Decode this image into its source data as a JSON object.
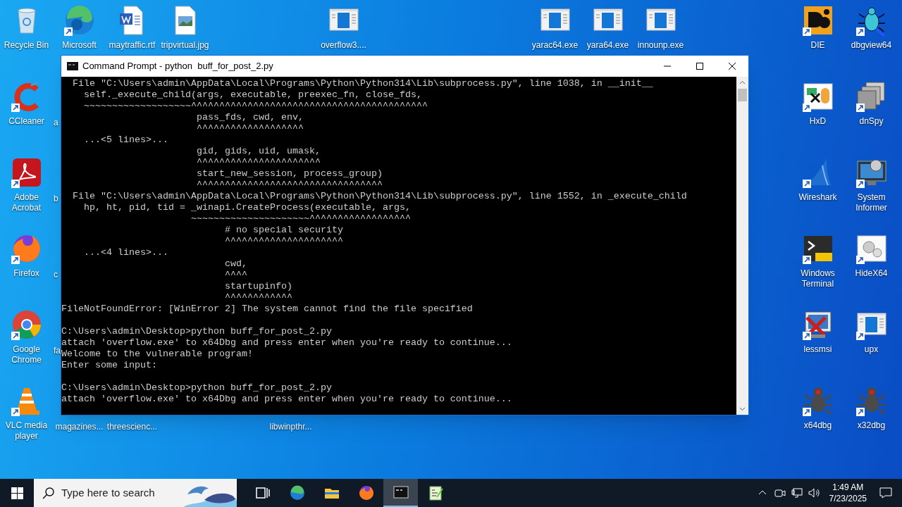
{
  "desktop": {
    "icons": [
      {
        "label": "Recycle Bin",
        "kind": "recycle",
        "shortcut": false
      },
      {
        "label": "Microsoft",
        "kind": "edge",
        "shortcut": true
      },
      {
        "label": "maytraffic.rtf",
        "kind": "word",
        "shortcut": false
      },
      {
        "label": "tripvirtual.jpg",
        "kind": "image",
        "shortcut": false
      },
      {
        "label": "overflow3....",
        "kind": "exe",
        "shortcut": false
      },
      {
        "label": "yarac64.exe",
        "kind": "exe",
        "shortcut": false
      },
      {
        "label": "yara64.exe",
        "kind": "exe",
        "shortcut": false
      },
      {
        "label": "innounp.exe",
        "kind": "exe",
        "shortcut": false
      },
      {
        "label": "DIE",
        "kind": "die",
        "shortcut": true
      },
      {
        "label": "dbgview64",
        "kind": "bug",
        "shortcut": true
      },
      {
        "label": "CCleaner",
        "kind": "ccleaner",
        "shortcut": true
      },
      {
        "label": "a",
        "kind": "hidden"
      },
      {
        "label": "HxD",
        "kind": "hxd",
        "shortcut": true
      },
      {
        "label": "dnSpy",
        "kind": "dnspy",
        "shortcut": true
      },
      {
        "label": "Adobe Acrobat",
        "kind": "acrobat",
        "shortcut": true
      },
      {
        "label": "b",
        "kind": "hidden"
      },
      {
        "label": "Wireshark",
        "kind": "wireshark",
        "shortcut": true
      },
      {
        "label": "System Informer",
        "kind": "sysinfo",
        "shortcut": true
      },
      {
        "label": "Firefox",
        "kind": "firefox",
        "shortcut": true
      },
      {
        "label": "c",
        "kind": "hidden"
      },
      {
        "label": "Windows Terminal",
        "kind": "terminal",
        "shortcut": true
      },
      {
        "label": "HideX64",
        "kind": "hidex",
        "shortcut": true
      },
      {
        "label": "Google Chrome",
        "kind": "chrome",
        "shortcut": true
      },
      {
        "label": "fa",
        "kind": "hidden"
      },
      {
        "label": "lessmsi",
        "kind": "lessmsi",
        "shortcut": true
      },
      {
        "label": "upx",
        "kind": "exe",
        "shortcut": true
      },
      {
        "label": "VLC media player",
        "kind": "vlc",
        "shortcut": true
      },
      {
        "label": "magazines...",
        "kind": "hidden"
      },
      {
        "label": "threescienc...",
        "kind": "hidden"
      },
      {
        "label": "libwinpthr...",
        "kind": "hidden"
      },
      {
        "label": "x64dbg",
        "kind": "dbg",
        "shortcut": true
      },
      {
        "label": "x32dbg",
        "kind": "dbg",
        "shortcut": true
      }
    ]
  },
  "window": {
    "title": "Command Prompt - python  buff_for_post_2.py",
    "console": {
      "blocks": [
        [
          "  File \"C:\\Users\\admin\\AppData\\Local\\Programs\\Python\\Python314\\Lib\\subprocess.py\", line 1038, in __init__",
          "    self._execute_child(args, executable, preexec_fn, close_fds,",
          "    ~~~~~~~~~~~~~~~~~~~^^^^^^^^^^^^^^^^^^^^^^^^^^^^^^^^^^^^^^^^^^",
          "                        pass_fds, cwd, env,",
          "                        ^^^^^^^^^^^^^^^^^^^",
          "    ...<5 lines>...",
          "                        gid, gids, uid, umask,",
          "                        ^^^^^^^^^^^^^^^^^^^^^^",
          "                        start_new_session, process_group)",
          "                        ^^^^^^^^^^^^^^^^^^^^^^^^^^^^^^^^^",
          "  File \"C:\\Users\\admin\\AppData\\Local\\Programs\\Python\\Python314\\Lib\\subprocess.py\", line 1552, in _execute_child",
          "    hp, ht, pid, tid = _winapi.CreateProcess(executable, args,",
          "                       ~~~~~~~~~~~~~~~~~~~~~^^^^^^^^^^^^^^^^^^",
          "                             # no special security",
          "                             ^^^^^^^^^^^^^^^^^^^^^",
          "    ...<4 lines>...",
          "                             cwd,",
          "                             ^^^^",
          "                             startupinfo)",
          "                             ^^^^^^^^^^^^",
          "FileNotFoundError: [WinError 2] The system cannot find the file specified"
        ],
        [
          "C:\\Users\\admin\\Desktop>python buff_for_post_2.py",
          "attach 'overflow.exe' to x64Dbg and press enter when you're ready to continue...",
          "Welcome to the vulnerable program!",
          "Enter some input:"
        ],
        [
          "C:\\Users\\admin\\Desktop>python buff_for_post_2.py",
          "attach 'overflow.exe' to x64Dbg and press enter when you're ready to continue..."
        ]
      ]
    }
  },
  "taskbar": {
    "search": {
      "placeholder": "Type here to search"
    },
    "apps": [
      {
        "kind": "taskview",
        "selected": false
      },
      {
        "kind": "edge",
        "selected": false
      },
      {
        "kind": "folder",
        "selected": false
      },
      {
        "kind": "firefox",
        "selected": false
      },
      {
        "kind": "console",
        "selected": true
      },
      {
        "kind": "notepad",
        "selected": false
      }
    ],
    "clock": {
      "time": "1:49 AM",
      "date": "7/23/2025"
    }
  }
}
